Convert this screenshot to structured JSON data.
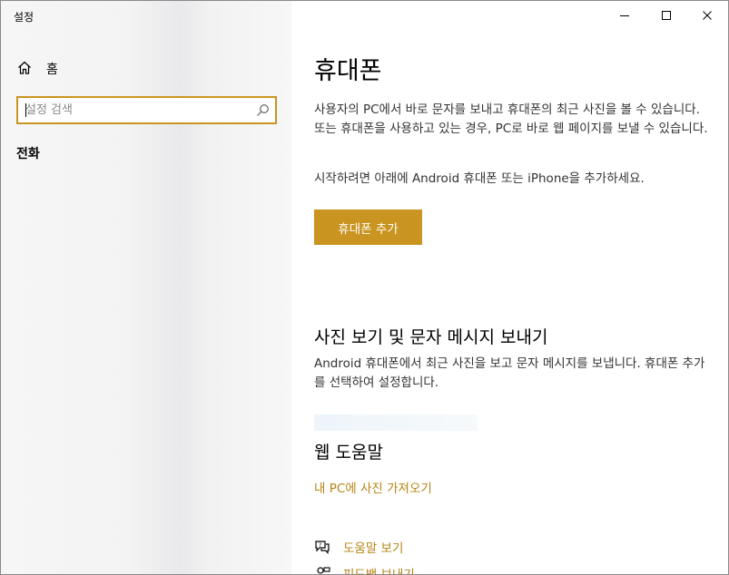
{
  "window": {
    "title": "설정",
    "controls": {
      "minimize": "minimize",
      "maximize": "maximize",
      "close": "close"
    }
  },
  "sidebar": {
    "home_label": "홈",
    "search": {
      "placeholder": "설정 검색",
      "value": ""
    },
    "section_label": "전화"
  },
  "content": {
    "title": "휴대폰",
    "intro": "사용자의 PC에서 바로 문자를 보내고 휴대폰의 최근 사진을 볼 수 있습니다. 또는 휴대폰을 사용하고 있는 경우, PC로 바로 웹 페이지를 보낼 수 있습니다.",
    "get_started": "시작하려면 아래에 Android 휴대폰 또는 iPhone을 추가하세요.",
    "add_phone_button": "휴대폰 추가",
    "photos_section": {
      "title": "사진 보기 및 문자 메시지 보내기",
      "description": "Android 휴대폰에서 최근 사진을 보고 문자 메시지를 보냅니다. 휴대폰 추가를 선택하여 설정합니다."
    },
    "help_section": {
      "title": "웹 도움말",
      "link": "내 PC에 사진 가져오기"
    },
    "links": {
      "get_help": "도움말 보기",
      "give_feedback": "피드백 보내기"
    }
  },
  "colors": {
    "accent": "#c9941f",
    "link": "#b78516"
  }
}
